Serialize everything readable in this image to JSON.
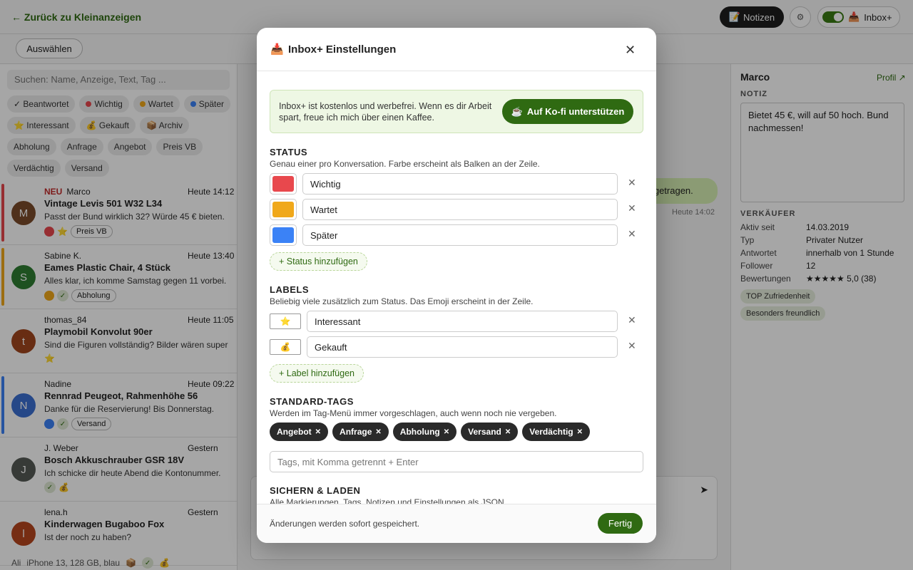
{
  "topbar": {
    "back_label": "← Zurück zu Kleinanzeigen",
    "notes_icon": "📝",
    "notes_label": "Notizen",
    "gear_icon": "⚙",
    "inbox_icon": "📥",
    "inbox_label": "Inbox+"
  },
  "subbar": {
    "select_label": "Auswählen"
  },
  "left": {
    "search_placeholder": "Suchen: Name, Anzeige, Text, Tag ...",
    "filters": [
      {
        "label": "✓ Beantwortet"
      },
      {
        "label": "Wichtig",
        "color": "#e8484d"
      },
      {
        "label": "Wartet",
        "color": "#f0a81a"
      },
      {
        "label": "Später",
        "color": "#3b82f6"
      },
      {
        "label": "⭐ Interessant"
      },
      {
        "label": "💰 Gekauft"
      },
      {
        "label": "📦 Archiv"
      },
      {
        "label": "Abholung"
      },
      {
        "label": "Anfrage"
      },
      {
        "label": "Angebot"
      },
      {
        "label": "Preis VB"
      },
      {
        "label": "Verdächtig"
      },
      {
        "label": "Versand"
      }
    ],
    "conversations": [
      {
        "new": "NEU",
        "name": "Marco",
        "time": "Heute 14:12",
        "title": "Vintage Levis 501 W32 L34",
        "msg": "Passt der Bund wirklich 32? Würde 45 € bieten.",
        "initial": "M",
        "avatar_color": "#7a4a2a",
        "bar_color": "#e8484d",
        "tag": "Preis VB",
        "emoji": "⭐"
      },
      {
        "new": "",
        "name": "Sabine K.",
        "time": "Heute 13:40",
        "title": "Eames Plastic Chair, 4 Stück",
        "msg": "Alles klar, ich komme Samstag gegen 11 vorbei.",
        "initial": "S",
        "avatar_color": "#2e7d32",
        "bar_color": "#f0a81a",
        "tag": "Abholung",
        "emoji": ""
      },
      {
        "new": "",
        "name": "thomas_84",
        "time": "Heute 11:05",
        "title": "Playmobil Konvolut 90er",
        "msg": "Sind die Figuren vollständig? Bilder wären super",
        "initial": "t",
        "avatar_color": "#a0461e",
        "bar_color": "",
        "tag": "",
        "emoji": "⭐"
      },
      {
        "new": "",
        "name": "Nadine",
        "time": "Heute 09:22",
        "title": "Rennrad Peugeot, Rahmenhöhe 56",
        "msg": "Danke für die Reservierung! Bis Donnerstag.",
        "initial": "N",
        "avatar_color": "#3b6fd1",
        "bar_color": "#3b82f6",
        "tag": "Versand",
        "emoji": ""
      },
      {
        "new": "",
        "name": "J. Weber",
        "time": "Gestern",
        "title": "Bosch Akkuschrauber GSR 18V",
        "msg": "Ich schicke dir heute Abend die Kontonummer.",
        "initial": "J",
        "avatar_color": "#555a55",
        "bar_color": "",
        "tag": "",
        "emoji": "💰"
      },
      {
        "new": "",
        "name": "lena.h",
        "time": "Gestern",
        "title": "Kinderwagen Bugaboo Fox",
        "msg": "Ist der noch zu haben?",
        "initial": "l",
        "avatar_color": "#b5461e",
        "bar_color": "",
        "tag": "",
        "emoji": ""
      }
    ],
    "footer_name": "Ali",
    "footer_text": "iPhone 13, 128 GB, blau"
  },
  "center": {
    "bubble_text": "n getragen.",
    "bubble_time": "Heute 14:02",
    "send_icon": "➤"
  },
  "right": {
    "name": "Marco",
    "profile_link": "Profil ↗",
    "note_heading": "NOTIZ",
    "note_text": "Bietet 45 €, will auf 50 hoch. Bund nachmessen!",
    "seller_heading": "VERKÄUFER",
    "rows": [
      {
        "k": "Aktiv seit",
        "v": "14.03.2019"
      },
      {
        "k": "Typ",
        "v": "Privater Nutzer"
      },
      {
        "k": "Antwortet",
        "v": "innerhalb von 1 Stunde"
      },
      {
        "k": "Follower",
        "v": "12"
      },
      {
        "k": "Bewertungen",
        "v": "★★★★★ 5,0 (38)"
      }
    ],
    "badges": [
      "TOP Zufriedenheit",
      "Besonders freundlich"
    ]
  },
  "modal": {
    "icon": "📥",
    "title": "Inbox+ Einstellungen",
    "close_icon": "✕",
    "kofi_text": "Inbox+ ist kostenlos und werbefrei. Wenn es dir Arbeit spart, freue ich mich über einen Kaffee.",
    "kofi_btn_icon": "☕",
    "kofi_btn_label": "Auf Ko-fi unterstützen",
    "status_heading": "STATUS",
    "status_desc": "Genau einer pro Konversation. Farbe erscheint als Balken an der Zeile.",
    "statuses": [
      {
        "label": "Wichtig",
        "color": "#e8484d"
      },
      {
        "label": "Wartet",
        "color": "#f0a81a"
      },
      {
        "label": "Später",
        "color": "#3b82f6"
      }
    ],
    "add_status": "+ Status hinzufügen",
    "labels_heading": "LABELS",
    "labels_desc": "Beliebig viele zusätzlich zum Status. Das Emoji erscheint in der Zeile.",
    "labels": [
      {
        "emoji": "⭐",
        "label": "Interessant"
      },
      {
        "emoji": "💰",
        "label": "Gekauft"
      }
    ],
    "add_label": "+ Label hinzufügen",
    "std_heading": "STANDARD-TAGS",
    "std_desc": "Werden im Tag-Menü immer vorgeschlagen, auch wenn noch nie vergeben.",
    "std_tags": [
      "Angebot",
      "Anfrage",
      "Abholung",
      "Versand",
      "Verdächtig"
    ],
    "tag_placeholder": "Tags, mit Komma getrennt + Enter",
    "save_heading": "SICHERN & LADEN",
    "save_desc": "Alle Markierungen, Tags, Notizen und Einstellungen als JSON",
    "footer_text": "Änderungen werden sofort gespeichert.",
    "done_label": "Fertig"
  }
}
